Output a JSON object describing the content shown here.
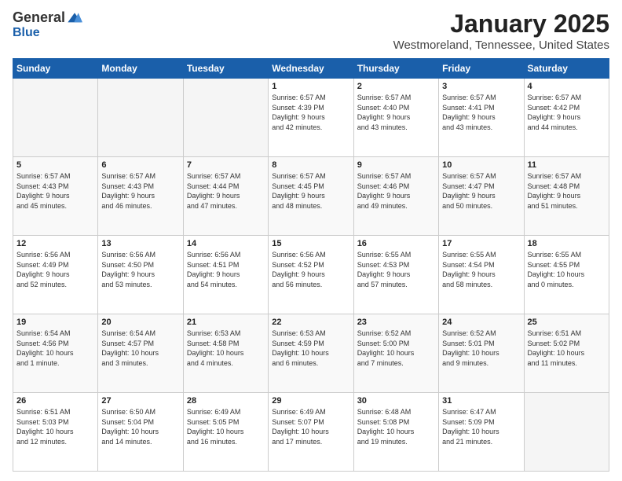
{
  "logo": {
    "general": "General",
    "blue": "Blue"
  },
  "header": {
    "title": "January 2025",
    "subtitle": "Westmoreland, Tennessee, United States"
  },
  "weekdays": [
    "Sunday",
    "Monday",
    "Tuesday",
    "Wednesday",
    "Thursday",
    "Friday",
    "Saturday"
  ],
  "weeks": [
    [
      {
        "day": "",
        "info": ""
      },
      {
        "day": "",
        "info": ""
      },
      {
        "day": "",
        "info": ""
      },
      {
        "day": "1",
        "info": "Sunrise: 6:57 AM\nSunset: 4:39 PM\nDaylight: 9 hours\nand 42 minutes."
      },
      {
        "day": "2",
        "info": "Sunrise: 6:57 AM\nSunset: 4:40 PM\nDaylight: 9 hours\nand 43 minutes."
      },
      {
        "day": "3",
        "info": "Sunrise: 6:57 AM\nSunset: 4:41 PM\nDaylight: 9 hours\nand 43 minutes."
      },
      {
        "day": "4",
        "info": "Sunrise: 6:57 AM\nSunset: 4:42 PM\nDaylight: 9 hours\nand 44 minutes."
      }
    ],
    [
      {
        "day": "5",
        "info": "Sunrise: 6:57 AM\nSunset: 4:43 PM\nDaylight: 9 hours\nand 45 minutes."
      },
      {
        "day": "6",
        "info": "Sunrise: 6:57 AM\nSunset: 4:43 PM\nDaylight: 9 hours\nand 46 minutes."
      },
      {
        "day": "7",
        "info": "Sunrise: 6:57 AM\nSunset: 4:44 PM\nDaylight: 9 hours\nand 47 minutes."
      },
      {
        "day": "8",
        "info": "Sunrise: 6:57 AM\nSunset: 4:45 PM\nDaylight: 9 hours\nand 48 minutes."
      },
      {
        "day": "9",
        "info": "Sunrise: 6:57 AM\nSunset: 4:46 PM\nDaylight: 9 hours\nand 49 minutes."
      },
      {
        "day": "10",
        "info": "Sunrise: 6:57 AM\nSunset: 4:47 PM\nDaylight: 9 hours\nand 50 minutes."
      },
      {
        "day": "11",
        "info": "Sunrise: 6:57 AM\nSunset: 4:48 PM\nDaylight: 9 hours\nand 51 minutes."
      }
    ],
    [
      {
        "day": "12",
        "info": "Sunrise: 6:56 AM\nSunset: 4:49 PM\nDaylight: 9 hours\nand 52 minutes."
      },
      {
        "day": "13",
        "info": "Sunrise: 6:56 AM\nSunset: 4:50 PM\nDaylight: 9 hours\nand 53 minutes."
      },
      {
        "day": "14",
        "info": "Sunrise: 6:56 AM\nSunset: 4:51 PM\nDaylight: 9 hours\nand 54 minutes."
      },
      {
        "day": "15",
        "info": "Sunrise: 6:56 AM\nSunset: 4:52 PM\nDaylight: 9 hours\nand 56 minutes."
      },
      {
        "day": "16",
        "info": "Sunrise: 6:55 AM\nSunset: 4:53 PM\nDaylight: 9 hours\nand 57 minutes."
      },
      {
        "day": "17",
        "info": "Sunrise: 6:55 AM\nSunset: 4:54 PM\nDaylight: 9 hours\nand 58 minutes."
      },
      {
        "day": "18",
        "info": "Sunrise: 6:55 AM\nSunset: 4:55 PM\nDaylight: 10 hours\nand 0 minutes."
      }
    ],
    [
      {
        "day": "19",
        "info": "Sunrise: 6:54 AM\nSunset: 4:56 PM\nDaylight: 10 hours\nand 1 minute."
      },
      {
        "day": "20",
        "info": "Sunrise: 6:54 AM\nSunset: 4:57 PM\nDaylight: 10 hours\nand 3 minutes."
      },
      {
        "day": "21",
        "info": "Sunrise: 6:53 AM\nSunset: 4:58 PM\nDaylight: 10 hours\nand 4 minutes."
      },
      {
        "day": "22",
        "info": "Sunrise: 6:53 AM\nSunset: 4:59 PM\nDaylight: 10 hours\nand 6 minutes."
      },
      {
        "day": "23",
        "info": "Sunrise: 6:52 AM\nSunset: 5:00 PM\nDaylight: 10 hours\nand 7 minutes."
      },
      {
        "day": "24",
        "info": "Sunrise: 6:52 AM\nSunset: 5:01 PM\nDaylight: 10 hours\nand 9 minutes."
      },
      {
        "day": "25",
        "info": "Sunrise: 6:51 AM\nSunset: 5:02 PM\nDaylight: 10 hours\nand 11 minutes."
      }
    ],
    [
      {
        "day": "26",
        "info": "Sunrise: 6:51 AM\nSunset: 5:03 PM\nDaylight: 10 hours\nand 12 minutes."
      },
      {
        "day": "27",
        "info": "Sunrise: 6:50 AM\nSunset: 5:04 PM\nDaylight: 10 hours\nand 14 minutes."
      },
      {
        "day": "28",
        "info": "Sunrise: 6:49 AM\nSunset: 5:05 PM\nDaylight: 10 hours\nand 16 minutes."
      },
      {
        "day": "29",
        "info": "Sunrise: 6:49 AM\nSunset: 5:07 PM\nDaylight: 10 hours\nand 17 minutes."
      },
      {
        "day": "30",
        "info": "Sunrise: 6:48 AM\nSunset: 5:08 PM\nDaylight: 10 hours\nand 19 minutes."
      },
      {
        "day": "31",
        "info": "Sunrise: 6:47 AM\nSunset: 5:09 PM\nDaylight: 10 hours\nand 21 minutes."
      },
      {
        "day": "",
        "info": ""
      }
    ]
  ]
}
